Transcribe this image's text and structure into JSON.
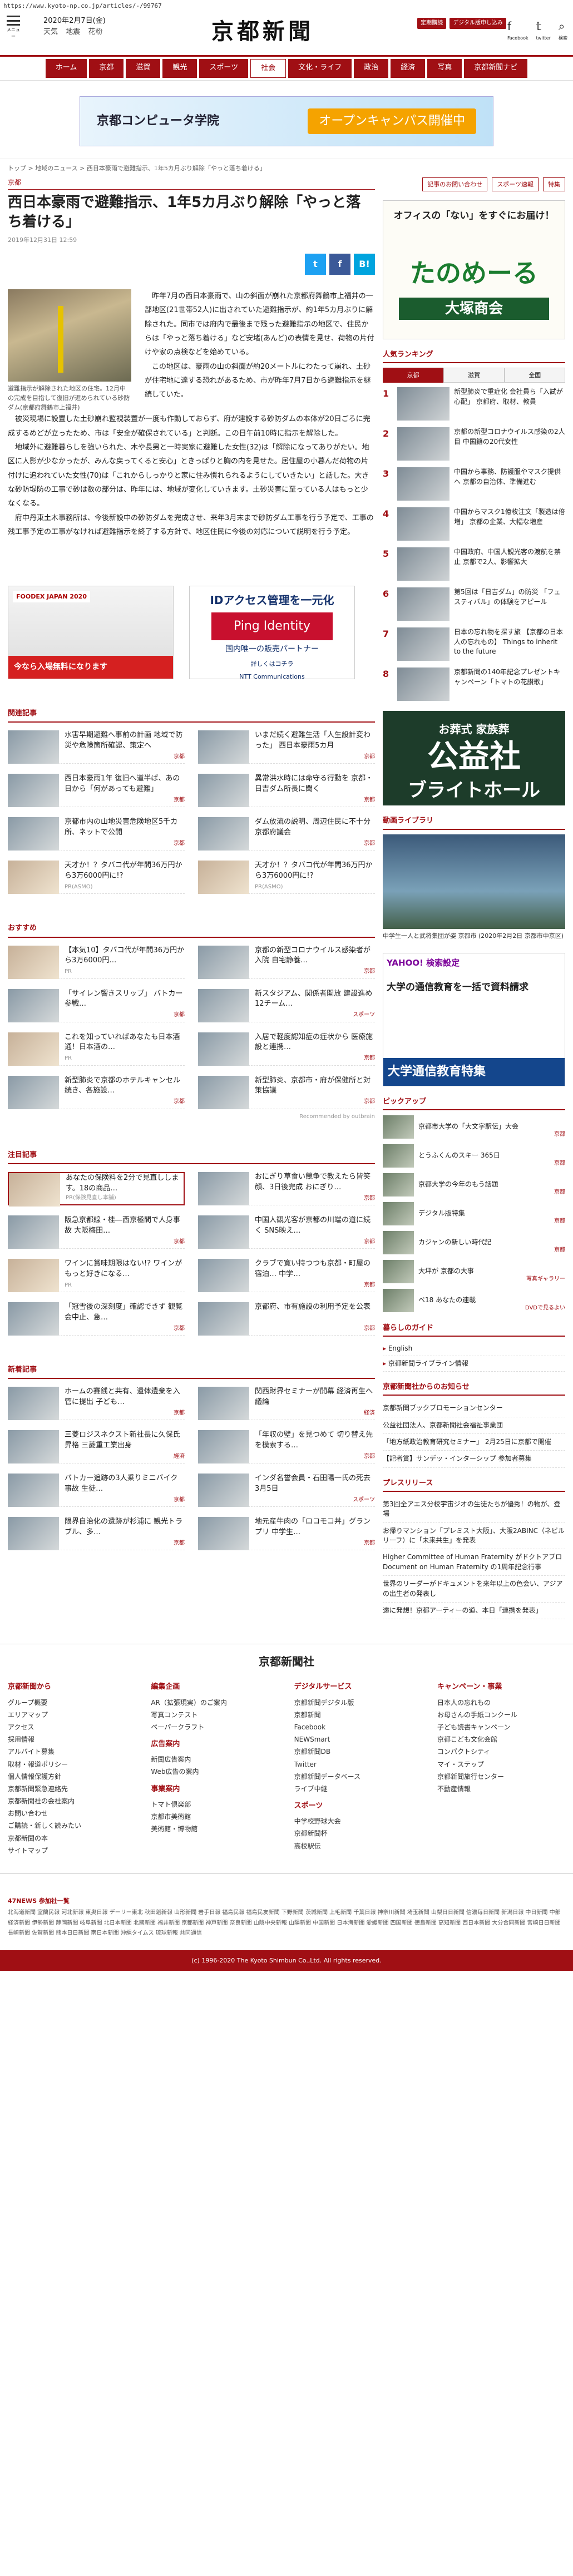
{
  "browser": {
    "url": "https://www.kyoto-np.co.jp/articles/-/99767"
  },
  "header": {
    "menu_label": "メニュー",
    "date": "2020年2月7日(金)",
    "weather": [
      "天気",
      "地震",
      "花粉"
    ],
    "logo": "京都新聞",
    "btn_subscribe": "定期購読",
    "btn_digital": "デジタル版申し込み",
    "social": [
      "Facebook",
      "twitter",
      "検索"
    ]
  },
  "nav": {
    "items": [
      "ホーム",
      "京都",
      "滋賀",
      "観光",
      "スポーツ",
      "社会",
      "文化・ライフ",
      "政治",
      "経済",
      "写真",
      "京都新聞ナビ"
    ],
    "current": "社会"
  },
  "banner_top": {
    "name": "京都コンピュータ学院",
    "cta": "オープンキャンパス開催中"
  },
  "breadcrumb": "トップ > 地域のニュース > 西日本豪雨で避難指示、1年5カ月ぶり解除「やっと落ち着ける」",
  "article": {
    "category": "京都",
    "title": "西日本豪雨で避難指示、1年5カ月ぶり解除「やっと落ち着ける」",
    "date": "2019年12月31日 12:59",
    "photo_caption": "避難指示が解除された地区の住宅。12月中の完成を目指して復旧が進められている砂防ダム(京都府舞鶴市上福井)",
    "paragraphs": [
      "昨年7月の西日本豪雨で、山の斜面が崩れた京都府舞鶴市上福井の一部地区(21世帯52人)に出されていた避難指示が、約1年5カ月ぶりに解除された。同市では府内で最後まで残った避難指示の地区で、住民からは「やっと落ち着ける」など安堵(あんど)の表情を見せ、荷物の片付けや家の点検などを始めている。",
      "この地区は、豪雨の山の斜面が約20メートルにわたって崩れ、土砂が住宅地に達する恐れがあるため、市が昨年7月7日から避難指示を継続していた。",
      "被災現場に設置した土砂崩れ監視装置が一度も作動しておらず、府が建設する砂防ダムの本体が20日ごろに完成するめどが立ったため、市は「安全が確保されている」と判断。この日午前10時に指示を解除した。",
      "地域外に避難暮らしを強いられた、木や長男と一時実家に避難した女性(32)は「解除になってありがたい。地区に人影が少なかったが、みんな戻ってくると安心」ときっぱりと胸の内を見せた。居住屋の小暮んだ荷物の片付けに追われていた女性(70)は「これからしっかりと家に住み慣れられるようにしていきたい」と話した。大きな砂防堤防の工事で砂は数の部分は、昨年には、地域が変化していきます。土砂災害に至っている人はもっと少なくなる。",
      "府中丹東土木事務所は、今後新設中の砂防ダムを完成させ、来年3月末まで砂防ダム工事を行う予定で、工事の残工事予定の工事がなければ避難指示を終了する方針で、地区住民に今後の対応について説明を行う予定。"
    ]
  },
  "ads_mid": {
    "ad_left_tag": "FOODEX JAPAN 2020",
    "ad_left_cta": "今なら入場無料になります",
    "ad_right_title": "IDアクセス管理を一元化",
    "ad_right_brand": "Ping Identity",
    "ad_right_sub": "国内唯一の販売パートナー",
    "ad_right_cta": "詳しくはコチラ",
    "ad_right_company": "NTT Communications"
  },
  "related": {
    "title": "関連記事",
    "items": [
      {
        "text": "水害早期避難へ事前の計画 地域で防災や危険箇所確認、策定へ",
        "src": "京都"
      },
      {
        "text": "いまだ続く避難生活「人生設計変わった」 西日本豪雨5カ月",
        "src": "京都"
      },
      {
        "text": "西日本豪雨1年 復旧へ道半ば、あの日から「何があっても避難」",
        "src": "京都"
      },
      {
        "text": "異常洪水時には命守る行動を 京都・日吉ダム所長に聞く",
        "src": "京都"
      },
      {
        "text": "京都市内の山地災害危険地区5千カ所、ネットで公開",
        "src": "京都"
      },
      {
        "text": "ダム放流の説明、周辺住民に不十分 京都府議会",
        "src": "京都"
      },
      {
        "text": "天才か！？タバコ代が年間36万円から3万6000円に!?",
        "src": "PR(ASMO)"
      },
      {
        "text": "天才か！？タバコ代が年間36万円から3万6000円に!?",
        "src": "PR(ASMO)"
      }
    ]
  },
  "recommend": {
    "title": "おすすめ",
    "items": [
      {
        "text": "【本気10】タバコ代が年間36万円から3万6000円…",
        "src": "PR"
      },
      {
        "text": "京都の新型コロナウイルス感染者が入院 自宅静養…",
        "src": "京都"
      },
      {
        "text": "「サイレン響きスリップ」 バトカー参戦…",
        "src": "京都"
      },
      {
        "text": "新スタジアム、関係者開放 建設進め 12チーム…",
        "src": "スポーツ"
      },
      {
        "text": "これを知っていればあなたも日本酒通！日本酒の…",
        "src": "PR"
      },
      {
        "text": "入居で軽度認知症の症状から 医療施設と連携…",
        "src": "京都"
      },
      {
        "text": "新型肺炎で京都のホテルキャンセル続き、各施設…",
        "src": "京都"
      },
      {
        "text": "新型肺炎、京都市・府が保健所と対策協議",
        "src": "京都"
      }
    ],
    "footer": "Recommended by outbrain"
  },
  "attention": {
    "title": "注目記事",
    "items": [
      {
        "text": "あなたの保険料を2分で見直しします。18の商品…",
        "src": "PR(保険見直し本舗)"
      },
      {
        "text": "おにぎり草食い競争で教えたら皆笑顔、3日後完成 おにぎり…",
        "src": "京都"
      },
      {
        "text": "阪急京都線・桂―西京極間で人身事故 大阪梅田…",
        "src": "京都"
      },
      {
        "text": "中国人観光客が京都の川端の道に続く SNS映え…",
        "src": "京都"
      },
      {
        "text": "ワインに賞味期限はない!? ワインがもっと好きになる…",
        "src": "PR"
      },
      {
        "text": "クラブで寛い持つつも京都・町屋の宿泊… 中学…",
        "src": "京都"
      },
      {
        "text": "「冠雪後の深刻度」確認できず 観覧会中止、急…",
        "src": "京都"
      },
      {
        "text": "京都府、市有施設の利用予定を公表",
        "src": "京都"
      }
    ]
  },
  "newest": {
    "title": "新着記事",
    "items": [
      {
        "text": "ホームの賽銭と共有、遺体遺棄を入管に提出 子ども…",
        "src": "京都"
      },
      {
        "text": "関西財界セミナーが開幕 経済再生へ議論",
        "src": "経済"
      },
      {
        "text": "三菱ロジスネクスト新社長に久保氏 昇格 三菱重工業出身",
        "src": "経済"
      },
      {
        "text": "「年収の壁」を見つめて 切り替え先を模索する…",
        "src": "京都"
      },
      {
        "text": "バトカー追跡の3人乗りミニバイク事故 生徒…",
        "src": "京都"
      },
      {
        "text": "インダ名誉会員・石田陽一氏の死去 3月5日",
        "src": "スポーツ"
      },
      {
        "text": "限界自治化の遺跡が杉浦に 観光トラブル、多…",
        "src": "京都"
      },
      {
        "text": "地元産牛肉の「ロコモコ丼」グランプリ 中学生…",
        "src": "京都"
      }
    ]
  },
  "footer": {
    "logo": "京都新聞社",
    "cols": [
      {
        "head": "京都新聞から",
        "items": [
          "グループ概要",
          "エリアマップ",
          "アクセス",
          "採用情報",
          "アルバイト募集",
          "取材・報道ポリシー",
          "個人情報保護方針",
          "京都新聞緊急連絡先",
          "京都新聞社の会社案内",
          "お問い合わせ",
          "ご購読・新しく読みたい",
          "京都新聞の本",
          "サイトマップ"
        ]
      },
      {
        "head": "編集企画",
        "items": [
          "AR（拡張現実）のご案内",
          "写真コンテスト",
          "ペーパークラフト"
        ],
        "head2": "広告案内",
        "items2": [
          "新聞広告案内",
          "Web広告の案内"
        ],
        "head3": "事業案内",
        "items3": [
          "トマト倶楽部",
          "京都市美術館",
          "美術館・博物館"
        ]
      },
      {
        "head": "デジタルサービス",
        "items": [
          "京都新聞デジタル版",
          "京都新聞",
          "Facebook",
          "NEWSmart",
          "京都新聞DB",
          "Twitter",
          "京都新聞データベース",
          "ライブ中継"
        ],
        "head2": "スポーツ",
        "items2": [
          "中学校野球大会",
          "京都新聞杯",
          "高校駅伝"
        ]
      },
      {
        "head": "キャンペーン・事業",
        "items": [
          "日本人の忘れもの",
          "お母さんの手紙コンクール",
          "子ども読書キャンペーン",
          "京都こども文化会館",
          "コンパクトシティ",
          "マイ・ステップ",
          "京都新聞旅行センター",
          "不動産情報"
        ]
      }
    ],
    "sites_head": "47NEWS 参加社一覧",
    "sites": "北海道新聞 室蘭民報 河北新報 東奥日報 デーリー東北 秋田魁新報 山形新聞 岩手日報 福島民報 福島民友新聞 下野新聞 茨城新聞 上毛新聞 千葉日報 神奈川新聞 埼玉新聞 山梨日日新聞 信濃毎日新聞 新潟日報 中日新聞 中部経済新聞 伊勢新聞 静岡新聞 岐阜新聞 北日本新聞 北國新聞 福井新聞 京都新聞 神戸新聞 奈良新聞 山陰中央新報 山陽新聞 中国新聞 日本海新聞 愛媛新聞 四国新聞 徳島新聞 高知新聞 西日本新聞 大分合同新聞 宮崎日日新聞 長崎新聞 佐賀新聞 熊本日日新聞 南日本新聞 沖縄タイムス 琉球新報 共同通信",
    "copyright": "(c) 1996-2020 The Kyoto Shimbun Co.,Ltd. All rights reserved."
  },
  "sidebar": {
    "btns": [
      "記事のお問い合わせ",
      "スポーツ速報",
      "特集"
    ],
    "ad1_top": "オフィスの「ない」をすぐにお届け！",
    "ad1_brand": "たのめーる",
    "ad1_company": "大塚商会",
    "ranking_title": "人気ランキング",
    "ranking_tabs": [
      "京都",
      "滋賀",
      "全国"
    ],
    "ranking": [
      {
        "n": "1",
        "text": "新型肺炎で重症化 会社員ら「入試が心配」 京都府、取材、教員"
      },
      {
        "n": "2",
        "text": "京都の新型コロナウイルス感染の2人目 中国籍の20代女性"
      },
      {
        "n": "3",
        "text": "中国から事務、防護服やマスク提供へ 京都の自治体、準備進む"
      },
      {
        "n": "4",
        "text": "中国からマスク1億枚注文「製造は倍増」 京都の企業、大幅な増産"
      },
      {
        "n": "5",
        "text": "中国政府、中国人観光客の渡航を禁止 京都で2人、影響拡大"
      },
      {
        "n": "6",
        "text": "第5回は「日吉ダム」の防災 「フェスティバル」の体験をアピール"
      },
      {
        "n": "7",
        "text": "日本の忘れ物を探す旅 【京都の日本人の忘れもの】 Things to inherit to the future"
      },
      {
        "n": "8",
        "text": "京都新聞の140年記念プレゼントキャンペーン「トマトの花讃歌」"
      }
    ],
    "ad2": {
      "a": "お葬式 家族葬",
      "b": "公益社",
      "c": "ブライトホール"
    },
    "video_title": "動画ライブラリ",
    "video_caption": "中学生一人と武将集団が姿 京都市 (2020年2月2日 京都市中京区)",
    "ad3": {
      "yh": "YAHOO! 検索設定",
      "m": "大学の通信教育を一括で資料請求",
      "bot": "大学通信教育特集"
    },
    "pickup_title": "ピックアップ",
    "pickup": [
      {
        "text": "京都市大学の「大文字駅伝」大会",
        "tag": "京都"
      },
      {
        "text": "とうふくんのスキー 365日",
        "tag": "京都"
      },
      {
        "text": "京都大学の今年のもう話題",
        "tag": "京都"
      },
      {
        "text": "デジタル版特集",
        "tag": "京都"
      },
      {
        "text": "カジャンの新しい時代記",
        "tag": "京都"
      },
      {
        "text": "大坪が 京都の大事",
        "tag": "写真ギャラリー"
      },
      {
        "text": "ベ18 あなたの連載",
        "tag": "DVDで見るよい"
      }
    ],
    "life_title": "暮らしのガイド",
    "life": [
      "English",
      "京都新聞ライブライン情報"
    ],
    "pr_title": "プレスリリース",
    "pr": [
      "第3回全アエス分校宇宙ジオの生徒たちが優秀！の物が、登場",
      "お帰りマンション「プレミスト大阪」、大阪2ABINC（ネビルリーフ）に「未来共生」を発表",
      "Higher Committee of Human Fraternity がドクトアプロ Document on Human Fraternity の1周年記念行事",
      "世界のリーダーがドキュメントを来年以上の色会い、アジアの出生者の発表し",
      "遠に発想！京都アーティーの道、本日「連携を発表」"
    ],
    "info_title": "京都新聞社からのお知らせ",
    "info": [
      "京都新聞ブックプロモーションセンター",
      "公益社団法人、京都新聞社会福祉事業団",
      "「地方紙政治教育研究セミナー」 2月25日に京都で開催",
      "【記者賞】サンデッ・インターシップ 参加者募集"
    ]
  }
}
